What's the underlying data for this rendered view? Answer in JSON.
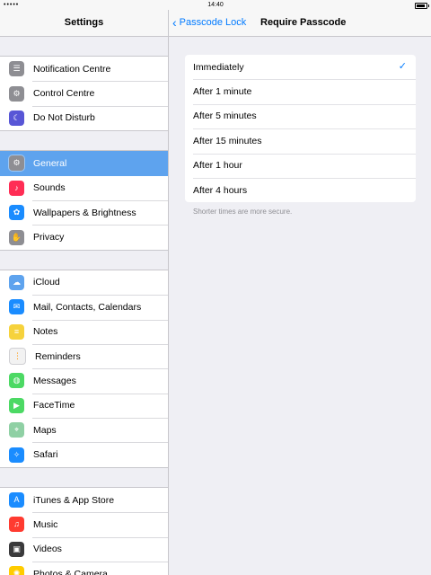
{
  "status_bar": {
    "signal": "•••••",
    "time": "14:40"
  },
  "left": {
    "title": "Settings",
    "groups": [
      {
        "items": [
          {
            "label": "Notification Centre",
            "icon": "notification-centre-icon",
            "color": "#8e8e93",
            "glyph": "☰"
          },
          {
            "label": "Control Centre",
            "icon": "control-centre-icon",
            "color": "#8e8e93",
            "glyph": "⚙"
          },
          {
            "label": "Do Not Disturb",
            "icon": "moon-icon",
            "color": "#5856d6",
            "glyph": "☾"
          }
        ]
      },
      {
        "items": [
          {
            "label": "General",
            "icon": "gear-icon",
            "color": "#8e8e93",
            "glyph": "⚙",
            "selected": true
          },
          {
            "label": "Sounds",
            "icon": "speaker-icon",
            "color": "#ff2d55",
            "glyph": "♪"
          },
          {
            "label": "Wallpapers & Brightness",
            "icon": "flower-icon",
            "color": "#1a8cff",
            "glyph": "✿"
          },
          {
            "label": "Privacy",
            "icon": "hand-icon",
            "color": "#8e8e93",
            "glyph": "✋"
          }
        ]
      },
      {
        "items": [
          {
            "label": "iCloud",
            "icon": "cloud-icon",
            "color": "#5ea3ee",
            "glyph": "☁"
          },
          {
            "label": "Mail, Contacts, Calendars",
            "icon": "mail-icon",
            "color": "#1a8cff",
            "glyph": "✉"
          },
          {
            "label": "Notes",
            "icon": "notes-icon",
            "color": "#f6d23c",
            "glyph": "≡"
          },
          {
            "label": "Reminders",
            "icon": "reminders-icon",
            "color": "#f2f2f2",
            "glyph": "⋮",
            "dark": true
          },
          {
            "label": "Messages",
            "icon": "messages-icon",
            "color": "#4cd964",
            "glyph": "◍"
          },
          {
            "label": "FaceTime",
            "icon": "facetime-icon",
            "color": "#4cd964",
            "glyph": "▶"
          },
          {
            "label": "Maps",
            "icon": "maps-icon",
            "color": "#8fd0a4",
            "glyph": "⌖"
          },
          {
            "label": "Safari",
            "icon": "safari-icon",
            "color": "#1a8cff",
            "glyph": "✧"
          }
        ]
      },
      {
        "items": [
          {
            "label": "iTunes & App Store",
            "icon": "app-store-icon",
            "color": "#1a8cff",
            "glyph": "A"
          },
          {
            "label": "Music",
            "icon": "music-icon",
            "color": "#ff3b30",
            "glyph": "♫"
          },
          {
            "label": "Videos",
            "icon": "videos-icon",
            "color": "#3a3a3c",
            "glyph": "▣"
          },
          {
            "label": "Photos & Camera",
            "icon": "photos-icon",
            "color": "#ffcc00",
            "glyph": "✺"
          }
        ]
      }
    ]
  },
  "right": {
    "back_label": "Passcode Lock",
    "title": "Require Passcode",
    "options": [
      {
        "label": "Immediately",
        "checked": true
      },
      {
        "label": "After 1 minute"
      },
      {
        "label": "After 5 minutes"
      },
      {
        "label": "After 15 minutes"
      },
      {
        "label": "After 1 hour"
      },
      {
        "label": "After 4 hours"
      }
    ],
    "check_glyph": "✓",
    "footer": "Shorter times are more secure."
  },
  "colors": {
    "accent": "#007aff",
    "selected_row": "#5ea3ee"
  }
}
